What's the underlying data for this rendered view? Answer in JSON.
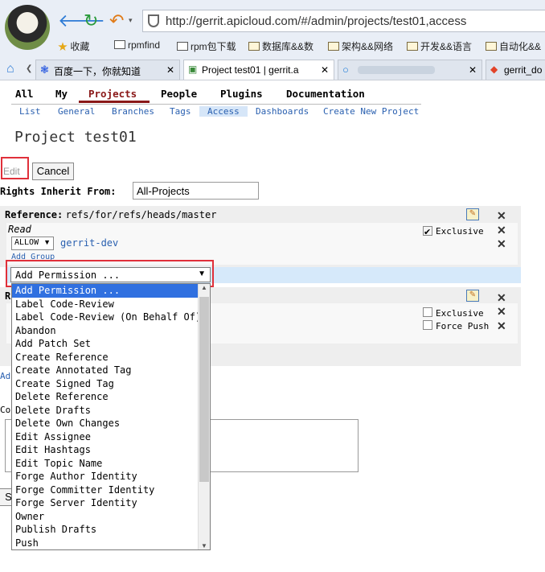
{
  "browser": {
    "url": "http://gerrit.apicloud.com/#/admin/projects/test01,access",
    "bookmarks": [
      "收藏",
      "rpmfind",
      "rpm包下载",
      "数据库&&数",
      "架构&&网络",
      "开发&&语言",
      "自动化&&"
    ],
    "tabs": [
      {
        "label": "百度一下，你就知道",
        "active": false
      },
      {
        "label": "Project test01 | gerrit.a",
        "active": true
      },
      {
        "label": "",
        "active": false
      },
      {
        "label": "gerrit_do",
        "active": false
      }
    ]
  },
  "nav": {
    "top": [
      "All",
      "My",
      "Projects",
      "People",
      "Plugins",
      "Documentation"
    ],
    "active": "Projects",
    "sub": [
      "List",
      "General",
      "Branches",
      "Tags",
      "Access",
      "Dashboards",
      "Create New Project"
    ],
    "sub_active": "Access"
  },
  "page": {
    "title": "Project test01",
    "edit_label": "Edit",
    "cancel_label": "Cancel",
    "inherit_label": "Rights Inherit From:",
    "inherit_value": "All-Projects"
  },
  "reference1": {
    "label": "Reference:",
    "value": "refs/for/refs/heads/master",
    "permission": "Read",
    "rule_action": "ALLOW",
    "group": "gerrit-dev",
    "add_group": "Add Group",
    "exclusive_label": "Exclusive",
    "exclusive_checked": true
  },
  "add_permission": {
    "selected": "Add Permission ...",
    "options": [
      "Add Permission ...",
      "Label Code-Review",
      "Label Code-Review (On Behalf Of)",
      "Abandon",
      "Add Patch Set",
      "Create Reference",
      "Create Annotated Tag",
      "Create Signed Tag",
      "Delete Reference",
      "Delete Drafts",
      "Delete Own Changes",
      "Edit Assignee",
      "Edit Hashtags",
      "Edit Topic Name",
      "Forge Author Identity",
      "Forge Committer Identity",
      "Forge Server Identity",
      "Owner",
      "Publish Drafts",
      "Push"
    ]
  },
  "reference2": {
    "label_fragment": "R",
    "exclusive_label": "Exclusive",
    "force_push_label": "Force Push"
  },
  "fragments": {
    "add": "Ad",
    "commit": "Co",
    "save": "S"
  }
}
